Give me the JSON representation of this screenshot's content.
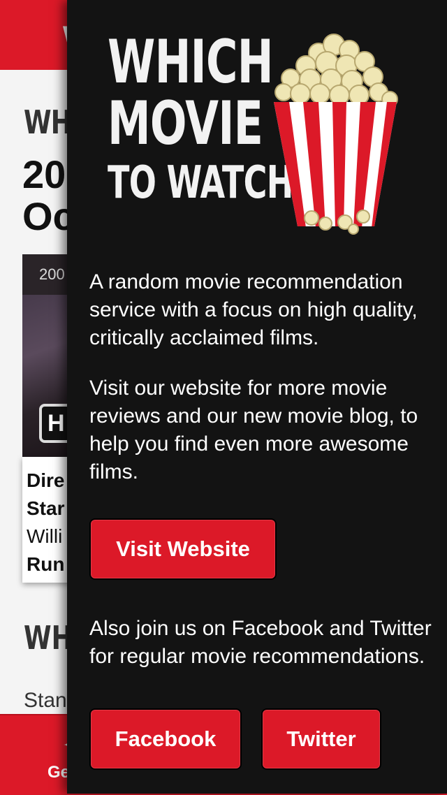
{
  "background_page": {
    "topbar_letter": "W",
    "heading": "WH",
    "title_line1": "20",
    "title_line2": "Oc",
    "card_year": "200",
    "badge": "H",
    "info_lines": [
      "Dire",
      "Star",
      "Willi",
      "Run"
    ],
    "heading2": "WH",
    "text2": "Stan",
    "bottombar_label": "Ge",
    "bottombar_icon": "✦"
  },
  "drawer": {
    "logo": {
      "line1": "WHICH",
      "line2": "MOVIE",
      "line3": "TO WATCH",
      "icon": "popcorn-icon"
    },
    "intro_text": "A random movie recommendation service with a focus on high quality, critically acclaimed films.",
    "website_text": "Visit our website for more movie reviews and our new movie blog, to help you find even more awesome films.",
    "visit_button": "Visit Website",
    "social_text": "Also join us on Facebook and Twitter for regular movie recommendations.",
    "facebook_button": "Facebook",
    "twitter_button": "Twitter"
  },
  "colors": {
    "brand_red": "#dc1928",
    "drawer_bg": "#131313",
    "text": "#ffffff"
  }
}
